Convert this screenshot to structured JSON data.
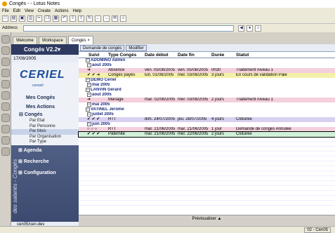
{
  "window": {
    "title": "Congés - - Lotus Notes"
  },
  "menu": [
    "File",
    "Edit",
    "View",
    "Create",
    "Actions",
    "Help"
  ],
  "address": {
    "label": "Address"
  },
  "tabs": [
    {
      "label": "Welcome"
    },
    {
      "label": "Workspace"
    },
    {
      "label": "Congés"
    }
  ],
  "nav": {
    "app_title": "Congés V2.2",
    "date": "17/08/2005",
    "logo": "CERIEL",
    "logo_sub": "conseil",
    "items": {
      "mes_conges": "Mes Congés",
      "mes_actions": "Mes Actions",
      "conges": "Congés",
      "par_etat": "Par Etat",
      "par_personne": "Par Personne",
      "par_mois": "Par Mois",
      "par_organisation": "Par Organisation",
      "par_type": "Par Type",
      "agenda": "Agenda",
      "recherche": "Recherche",
      "configuration": "Configuration"
    },
    "vertical": "des salariés - Congés",
    "footer": "cen05/cen-dev"
  },
  "actions": {
    "demande": "Demande de congés",
    "modifier": "Modifier"
  },
  "table": {
    "headers": [
      "Suivi",
      "Type Congés",
      "Date début",
      "Date fin",
      "Durée",
      "Statut"
    ],
    "rows": [
      {
        "kind": "cat1",
        "text": "ADOMINO Admin"
      },
      {
        "kind": "cat2",
        "text": "aout 2005"
      },
      {
        "kind": "data",
        "style": "pink",
        "suivi": "➜",
        "type": "Absence",
        "debut": "ven. 05/08/2005",
        "fin": "ven. 05/08/2005",
        "duree": "0h30",
        "statut": "Traitement niveau 1"
      },
      {
        "kind": "data",
        "style": "yellow",
        "suivi": "✔ ✔ ➜",
        "type": "Congés payés",
        "debut": "lun. 01/08/2005",
        "fin": "mer. 03/08/2005",
        "duree": "3 jours",
        "statut": "En cours de validation Paie"
      },
      {
        "kind": "cat1",
        "text": "DEMO Ceriel"
      },
      {
        "kind": "cat2",
        "text": "mai 2005"
      },
      {
        "kind": "cat1",
        "text": "LANVIN Gerard"
      },
      {
        "kind": "cat2",
        "text": "aout 2005"
      },
      {
        "kind": "data",
        "style": "pink",
        "suivi": "➜",
        "type": "Mariage",
        "debut": "mar. 02/08/2005",
        "fin": "mer. 03/08/2005",
        "duree": "2 jours",
        "statut": "Traitement niveau 1"
      },
      {
        "kind": "cat2",
        "text": "mai 2005"
      },
      {
        "kind": "cat1",
        "text": "VATINEL Jerome"
      },
      {
        "kind": "cat2",
        "text": "juillet 2005"
      },
      {
        "kind": "data",
        "style": "purple",
        "suivi": "✔ ✔ ✔",
        "type": "RTT",
        "debut": "dim. 24/07/2005",
        "fin": "jeu. 28/07/2005",
        "duree": "4 jours",
        "statut": "Cloturée"
      },
      {
        "kind": "cat2",
        "text": "juin 2005"
      },
      {
        "kind": "data",
        "style": "pink",
        "suivi": "○ ○ ○",
        "type": "RTT",
        "debut": "mar. 21/06/2005",
        "fin": "mar. 21/06/2005",
        "duree": "1 jour",
        "statut": "Demande de congés Annulée"
      },
      {
        "kind": "data",
        "style": "green",
        "suivi": "✔ ✔ ✔",
        "type": "Paternité",
        "debut": "mar. 21/06/2005",
        "fin": "mer. 22/06/2005",
        "duree": "2 jours",
        "statut": "Cloturée"
      }
    ]
  },
  "preview": "Prévisualiser ▲",
  "status": {
    "location": "02 - Cen05"
  }
}
